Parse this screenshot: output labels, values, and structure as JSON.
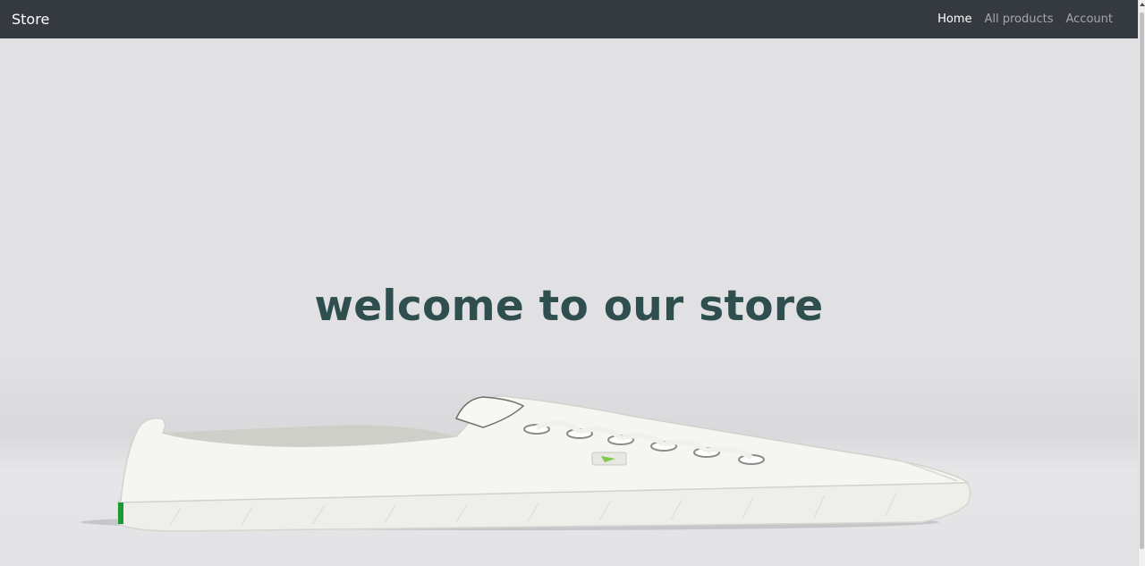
{
  "navbar": {
    "brand": "Store",
    "links": [
      {
        "label": "Home",
        "active": true
      },
      {
        "label": "All products",
        "active": false
      },
      {
        "label": "Account",
        "active": false
      }
    ]
  },
  "hero": {
    "title": "welcome to our store",
    "image_icon": "sneaker-image"
  },
  "colors": {
    "navbar_bg": "#343a40",
    "title_color": "#2f4f4f",
    "hero_bg": "#e2e2e4"
  }
}
